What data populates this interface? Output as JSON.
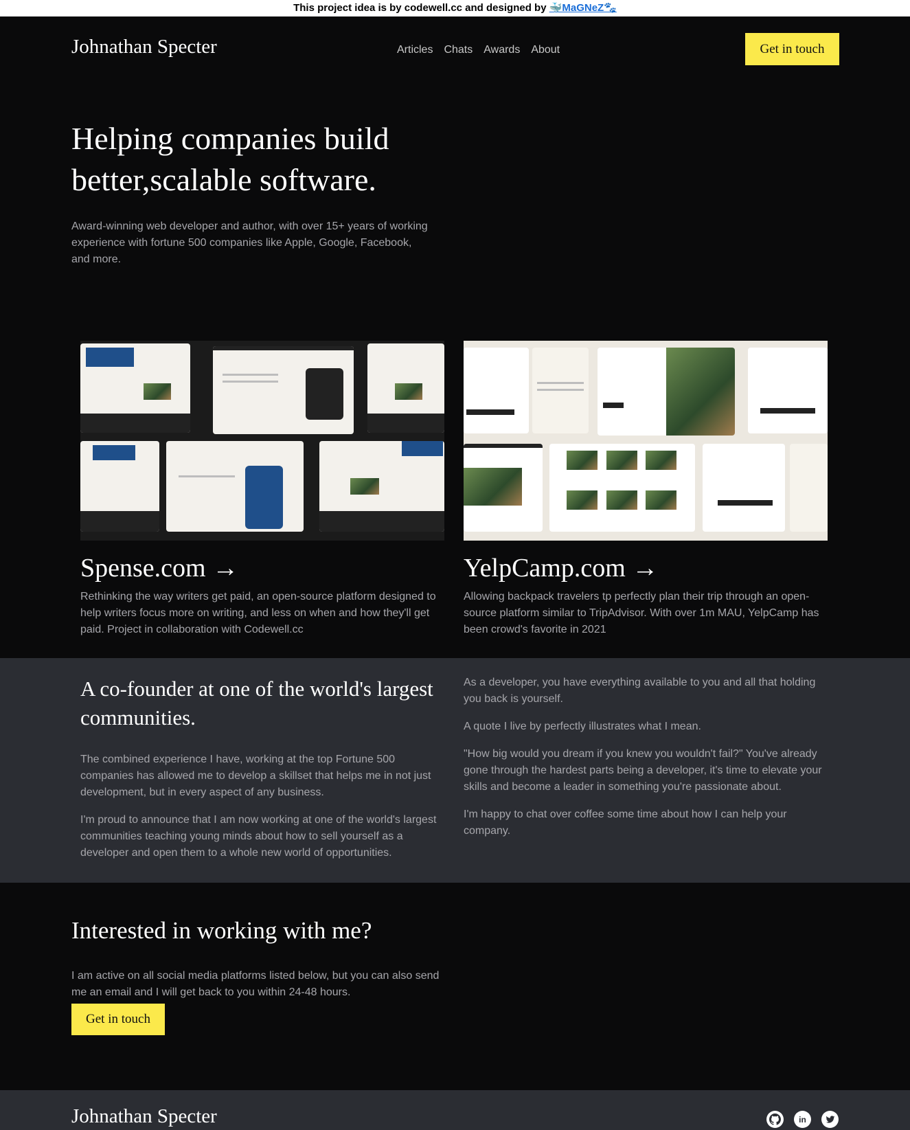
{
  "attribution": {
    "text": "This project idea is by codewell.cc and designed by",
    "link": "🐳MaGNeZ🐾"
  },
  "header": {
    "brand": "Johnathan Specter",
    "nav": [
      "Articles",
      "Chats",
      "Awards",
      "About"
    ],
    "cta": "Get in touch"
  },
  "hero": {
    "title": "Helping companies build better,scalable software.",
    "subtitle": "Award-winning web developer and author, with over 15+ years of working experience with fortune 500 companies like Apple, Google, Facebook, and more."
  },
  "projects": [
    {
      "title": "Spense.com →",
      "description": "Rethinking the way writers get paid, an open-source platform designed to help writers focus more on writing, and less on when and how they'll get paid. Project in collaboration with Codewell.cc"
    },
    {
      "title": "YelpCamp.com →",
      "description": "Allowing backpack travelers tp perfectly plan their trip through an open-source platform similar to TripAdvisor. With over 1m MAU, YelpCamp has been crowd's favorite in 2021"
    }
  ],
  "about": {
    "title": "A co-founder at one of the world's largest communities.",
    "left_paragraphs": [
      "The combined experience I have, working at the top Fortune 500 companies has allowed me to develop a skillset that helps me in not just development, but in every aspect of any business.",
      "I'm proud to announce that I am now working at one of the world's largest communities teaching young minds about how to sell yourself as a developer and open them to a whole new world of opportunities."
    ],
    "right_paragraphs": [
      "As a developer, you have everything available to you and all that holding you back is yourself.",
      "A quote I live by perfectly illustrates what I mean.",
      "\"How big would you dream if you knew you wouldn't fail?\" You've already gone through the hardest parts being a developer, it's time to elevate your skills and become a leader in something you're passionate about.",
      "I'm happy to chat over coffee some time about how I can help your company."
    ]
  },
  "contact": {
    "title": "Interested in working with me?",
    "text": "I am active on all social media platforms listed below, but you can also send me an email and I will get back to you within 24-48 hours.",
    "cta": "Get in touch"
  },
  "footer": {
    "brand": "Johnathan Specter",
    "social": [
      {
        "icon": "github-icon",
        "glyph": ""
      },
      {
        "icon": "linkedin-icon",
        "glyph": "in"
      },
      {
        "icon": "twitter-icon",
        "glyph": ""
      }
    ]
  },
  "colors": {
    "accent": "#fbe94b",
    "background": "#0a0a0b",
    "band": "#2b2d33",
    "muted_text": "#a6a6ab"
  }
}
